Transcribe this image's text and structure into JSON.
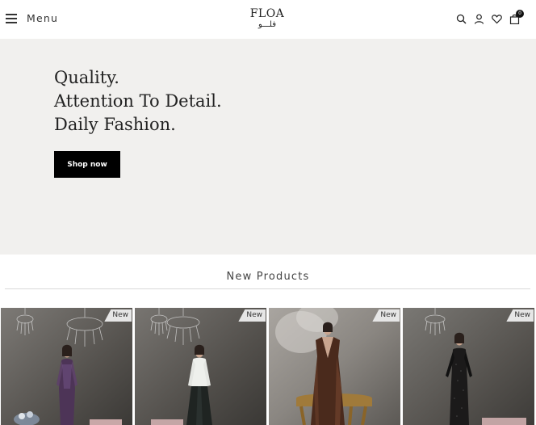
{
  "header": {
    "menu_label": "Menu",
    "logo_latin": "FLOA",
    "logo_arabic": "فلـــو",
    "cart_count": "0",
    "icons": [
      "search-icon",
      "user-icon",
      "heart-icon",
      "shopping-bag-icon"
    ]
  },
  "hero": {
    "line1": "Quality.",
    "line2": "Attention To Detail.",
    "line3": "Daily Fashion.",
    "cta_label": "Shop now"
  },
  "new_products": {
    "title": "New Products",
    "items": [
      {
        "badge": "New"
      },
      {
        "badge": "New"
      },
      {
        "badge": "New"
      },
      {
        "badge": "New"
      }
    ]
  },
  "colors": {
    "hero_bg": "#f1f0ee",
    "button_bg": "#000000",
    "badge_bg": "#e6e6e6"
  }
}
